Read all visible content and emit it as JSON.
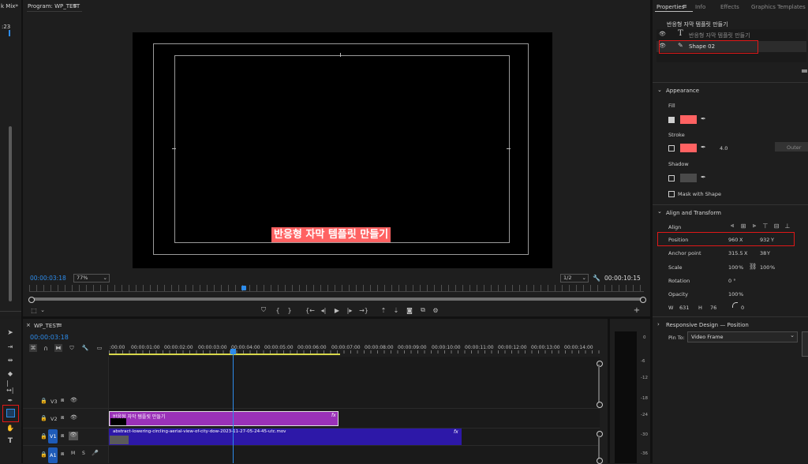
{
  "left_panel": {
    "title": "k Mix",
    "expand": "»",
    "value": ":23"
  },
  "program": {
    "title": "Program: WP_TEST",
    "menu": "≡",
    "caption": "반응형 자막 템플릿 만들기",
    "timecode": "00:00:03:18",
    "zoom": "77%",
    "resolution": "1/2",
    "duration": "00:00:10:15"
  },
  "properties": {
    "tabs": [
      "Properties",
      "Info",
      "Effects",
      "Graphics Templates"
    ],
    "tab_menu": "≡",
    "clip_title": "반응형 자막 템플릿 만들기",
    "layers": [
      {
        "name": "반응형 자막 템플릿 만들기",
        "icon": "text-T-icon"
      },
      {
        "name": "Shape 02",
        "icon": "pen-icon"
      }
    ],
    "appearance": {
      "heading": "Appearance",
      "fill_label": "Fill",
      "stroke_label": "Stroke",
      "stroke_width": "4.0",
      "stroke_type": "Outer",
      "shadow_label": "Shadow",
      "mask_label": "Mask with Shape",
      "fill_color": "#ff6262"
    },
    "align": {
      "heading": "Align and Transform",
      "align_label": "Align",
      "position_label": "Position",
      "pos_x": "960",
      "x": "X",
      "pos_y": "932",
      "y": "Y",
      "anchor_label": "Anchor point",
      "anchor_x": "315.5",
      "anchor_y": "38",
      "scale_label": "Scale",
      "scale": "100",
      "scale2": "100",
      "percent": "%",
      "rotation_label": "Rotation",
      "rotation": "0 °",
      "opacity_label": "Opacity",
      "opacity": "100",
      "w_label": "W",
      "w": "631",
      "h_label": "H",
      "h": "76",
      "corner": "0"
    },
    "responsive": {
      "heading": "Responsive Design — Position",
      "pin_label": "Pin To:",
      "pin_value": "Video Frame"
    }
  },
  "timeline": {
    "title": "WP_TEST",
    "menu": "≡",
    "close": "×",
    "timecode": "00:00:03:18",
    "ticks": [
      ":00:00",
      "00:00:01:00",
      "00:00:02:00",
      "00:00:03:00",
      "00:00:04:00",
      "00:00:05:00",
      "00:00:06:00",
      "00:00:07:00",
      "00:00:08:00",
      "00:00:09:00",
      "00:00:10:00",
      "00:00:11:00",
      "00:00:12:00",
      "00:00:13:00",
      "00:00:14:00"
    ],
    "tracks": [
      {
        "name": "V3"
      },
      {
        "name": "V2"
      },
      {
        "name": "V1"
      },
      {
        "name": "A1",
        "m": "M",
        "s": "S"
      }
    ],
    "clip_v2": {
      "label": "반응형 자막 템플릿 만들기",
      "fx": "fx"
    },
    "clip_v1": {
      "label": "abstract-lowering-circling-aerial-view-of-city-dow-2023-11-27-05-24-45-utc.mov",
      "fx": "fx"
    }
  },
  "meter": {
    "labels": [
      "0",
      "-6",
      "-12",
      "-18",
      "-24",
      "-30",
      "-36"
    ]
  }
}
